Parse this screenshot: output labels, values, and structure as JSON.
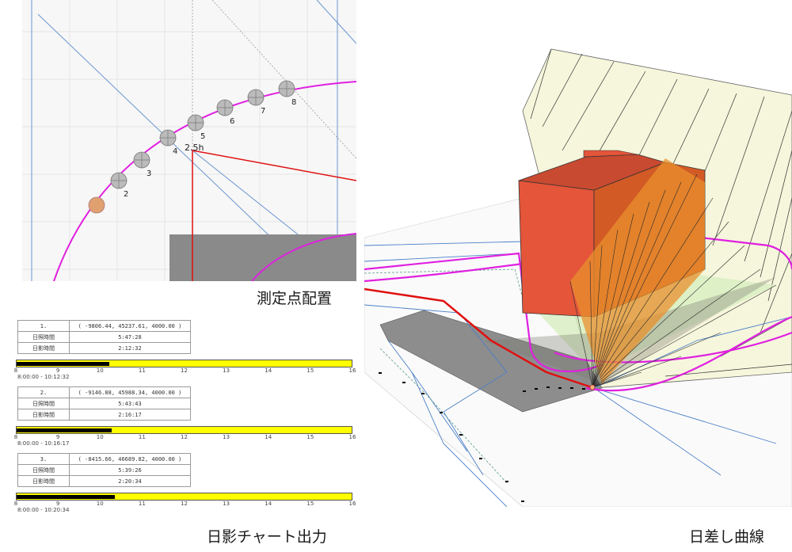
{
  "plan": {
    "points": [
      {
        "label": "2"
      },
      {
        "label": "3"
      },
      {
        "label": "4"
      },
      {
        "label": "5"
      },
      {
        "label": "6"
      },
      {
        "label": "7"
      },
      {
        "label": "8"
      }
    ],
    "height_label": "2.5h",
    "colors": {
      "curve": "#e020e0",
      "boundary": "#e01010",
      "axis": "#4a7fc8",
      "point": "#bbbbbb",
      "selected_point": "#e0a070"
    }
  },
  "captions": {
    "placement": "測定点配置",
    "chart_output": "日影チャート出力",
    "sun_curve": "日差し曲線"
  },
  "chart": {
    "row_labels": {
      "sun": "日照時間",
      "shade": "日影時間"
    },
    "axis_ticks": [
      "8",
      "9",
      "10",
      "11",
      "12",
      "13",
      "14",
      "15",
      "16"
    ],
    "axis_range": [
      8,
      16
    ],
    "bar_color": "#ffff00",
    "records": [
      {
        "index": "1.",
        "coord": "( -9806.44, 45237.61, 4000.00 )",
        "sun": "5:47:28",
        "shade": "2:12:32",
        "range": "8:00:00 - 10:12:32",
        "shade_end": 10.2089
      },
      {
        "index": "2.",
        "coord": "( -9146.88, 45988.34, 4000.00 )",
        "sun": "5:43:43",
        "shade": "2:16:17",
        "range": "8:00:00 - 10:16:17",
        "shade_end": 10.2714
      },
      {
        "index": "3.",
        "coord": "( -8415.66, 46689.82, 4000.00 )",
        "sun": "5:39:26",
        "shade": "2:20:34",
        "range": "8:00:00 - 10:20:34",
        "shade_end": 10.3428
      }
    ]
  },
  "view3d": {
    "colors": {
      "building": "#e4553a",
      "building_side": "#c8442c",
      "shadow": "#8a8a8a",
      "fan": "#f4f4d8",
      "green": "#d8efc0",
      "curve": "#e020e0",
      "line": "#4a7fc8"
    }
  }
}
